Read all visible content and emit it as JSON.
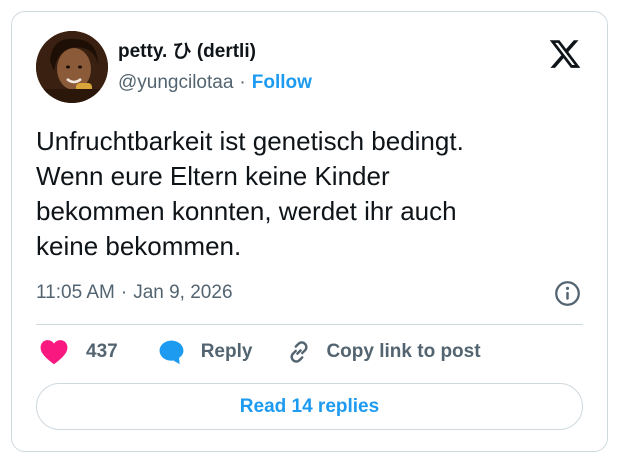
{
  "author": {
    "display_name": "petty. ひ (dertli)",
    "handle": "@yungcilotaa",
    "separator": "·",
    "follow_label": "Follow",
    "avatar_icon": "profile-photo"
  },
  "brand": {
    "logo_icon": "x-logo-icon"
  },
  "tweet": {
    "lines": [
      "Unfruchtbarkeit ist genetisch bedingt.",
      "Wenn eure Eltern keine Kinder",
      "bekommen konnten, werdet ihr auch",
      "keine bekommen."
    ],
    "time": "11:05 AM",
    "separator": "·",
    "date": "Jan 9, 2026"
  },
  "actions": {
    "like_count": "437",
    "reply_label": "Reply",
    "copy_label": "Copy link to post"
  },
  "footer": {
    "read_replies_label": "Read 14 replies"
  },
  "colors": {
    "accent": "#1d9bf0",
    "like": "#f91880",
    "text": "#0f1419",
    "muted": "#536471",
    "border": "#cfd9de"
  }
}
